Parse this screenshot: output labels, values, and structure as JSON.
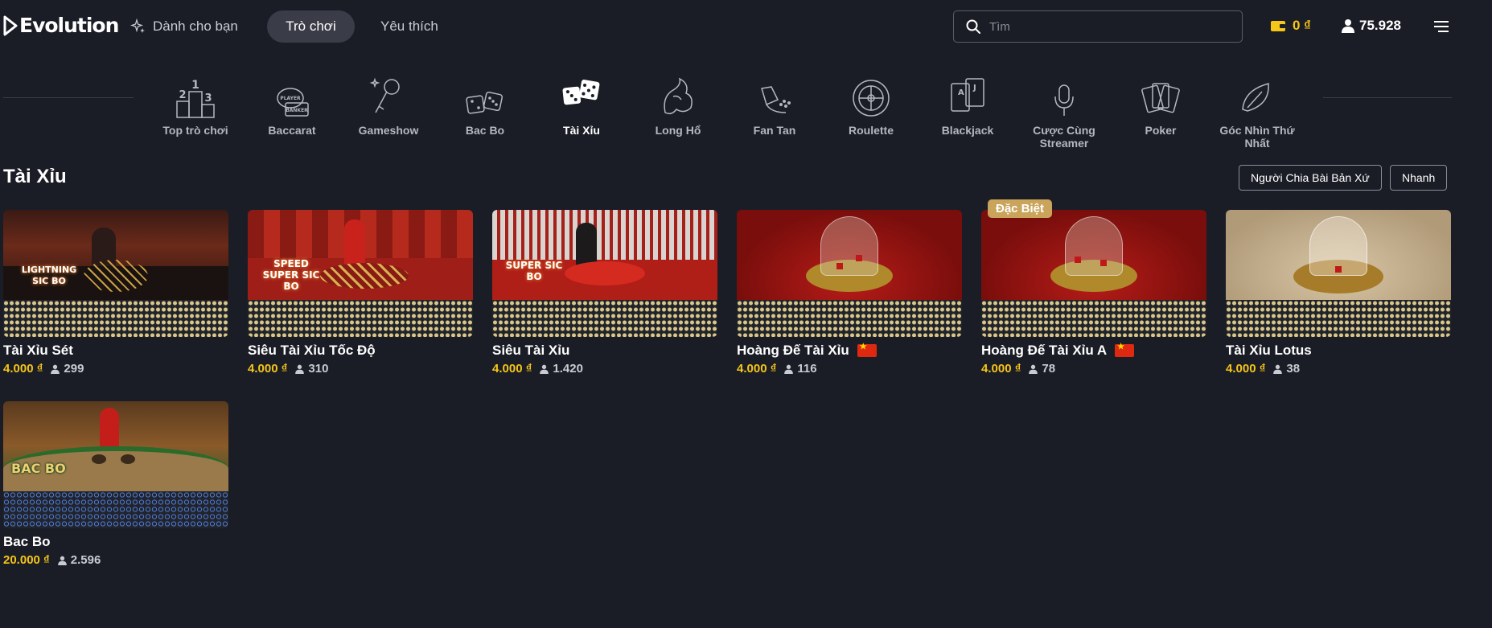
{
  "brand": {
    "name": "Evolution"
  },
  "nav": {
    "foryou": "Dành cho bạn",
    "games": "Trò chơi",
    "favorites": "Yêu thích"
  },
  "search": {
    "placeholder": "Tìm"
  },
  "wallet": {
    "balance": "0 ₫"
  },
  "players_total": "75.928",
  "categories": [
    {
      "label": "Top trò chơi",
      "icon": "podium-icon"
    },
    {
      "label": "Baccarat",
      "icon": "baccarat-icon"
    },
    {
      "label": "Gameshow",
      "icon": "microphone-icon"
    },
    {
      "label": "Bac Bo",
      "icon": "dice-pair-icon"
    },
    {
      "label": "Tài Xỉu",
      "icon": "dice-icon"
    },
    {
      "label": "Long Hổ",
      "icon": "dragon-icon"
    },
    {
      "label": "Fan Tan",
      "icon": "fan-tan-icon"
    },
    {
      "label": "Roulette",
      "icon": "roulette-icon"
    },
    {
      "label": "Blackjack",
      "icon": "cards-icon"
    },
    {
      "label": "Cược Cùng Streamer",
      "icon": "streamer-mic-icon"
    },
    {
      "label": "Poker",
      "icon": "poker-cards-icon"
    },
    {
      "label": "Góc Nhìn Thứ Nhất",
      "icon": "first-person-icon"
    }
  ],
  "section": {
    "title": "Tài Xỉu",
    "filters": [
      "Người Chia Bài Bản Xứ",
      "Nhanh"
    ]
  },
  "games": [
    {
      "title": "Tài Xỉu Sét",
      "price": "4.000 ₫",
      "players": "299",
      "overlay": "LIGHTNING SIC BO"
    },
    {
      "title": "Siêu Tài Xỉu Tốc Độ",
      "price": "4.000 ₫",
      "players": "310",
      "overlay": "SPEED SUPER SIC BO"
    },
    {
      "title": "Siêu Tài Xỉu",
      "price": "4.000 ₫",
      "players": "1.420",
      "overlay": "SUPER SIC BO"
    },
    {
      "title": "Hoàng Đế Tài Xỉu",
      "price": "4.000 ₫",
      "players": "116",
      "flag": "china"
    },
    {
      "title": "Hoàng Đế Tài Xỉu A",
      "price": "4.000 ₫",
      "players": "78",
      "flag": "china",
      "badge": "Đặc Biệt"
    },
    {
      "title": "Tài Xỉu Lotus",
      "price": "4.000 ₫",
      "players": "38"
    },
    {
      "title": "Bac Bo",
      "price": "20.000 ₫",
      "players": "2.596",
      "overlay": "BAC BO"
    }
  ],
  "colors": {
    "background": "#1b1d26",
    "accent_gold": "#f5c518",
    "active_pill": "#3a3c47"
  }
}
